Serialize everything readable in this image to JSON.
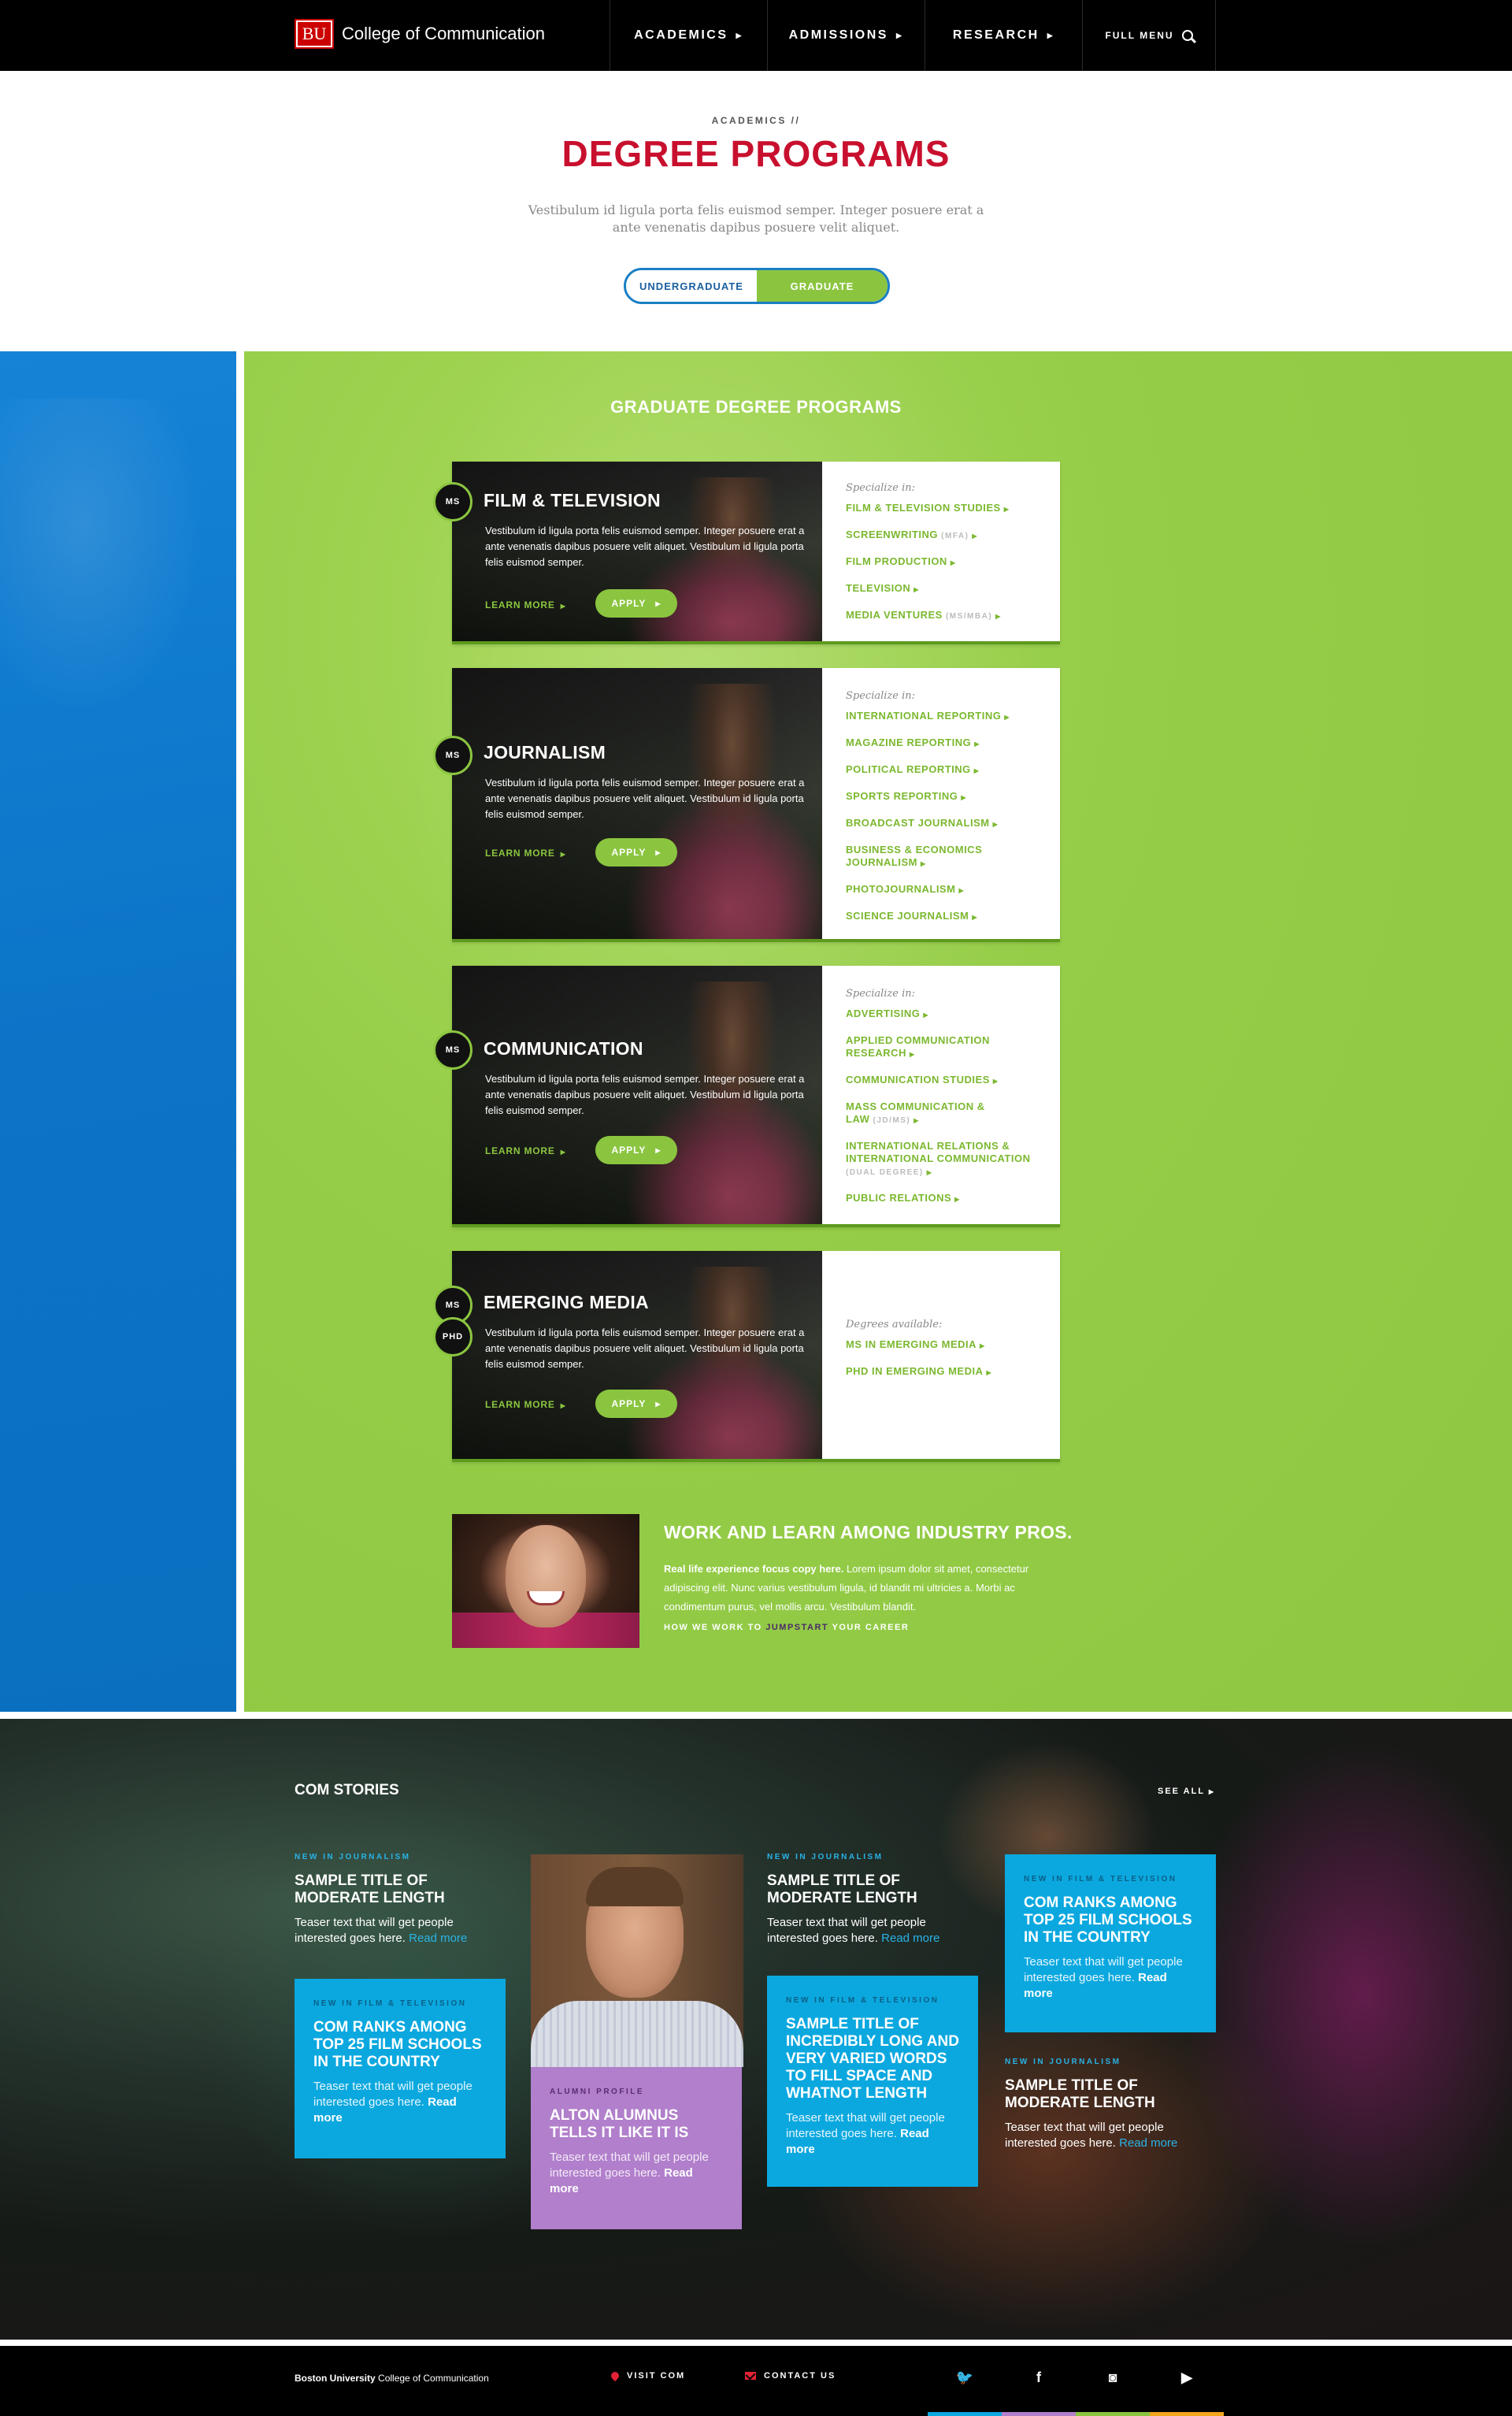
{
  "header": {
    "logo_text": "BU",
    "site_name": "College of Communication",
    "nav": [
      {
        "label": "ACADEMICS"
      },
      {
        "label": "ADMISSIONS"
      },
      {
        "label": "RESEARCH"
      },
      {
        "label": "FULL MENU"
      }
    ]
  },
  "intro": {
    "breadcrumb": "ACADEMICS //",
    "title": "DEGREE PROGRAMS",
    "text": "Vestibulum id ligula porta felis euismod semper. Integer posuere erat a ante venenatis dapibus posuere velit aliquet.",
    "toggle": {
      "undergraduate": "UNDERGRADUATE",
      "graduate": "GRADUATE"
    }
  },
  "programs": {
    "section_title": "GRADUATE DEGREE PROGRAMS",
    "cards": [
      {
        "badges": [
          "MS"
        ],
        "name": "FILM & TELEVISION",
        "desc": "Vestibulum id ligula porta felis euismod semper.  Integer posuere erat a ante venenatis dapibus posuere velit aliquet. Vestibulum id ligula porta felis euismod semper.",
        "learn_more": "LEARN MORE",
        "apply": "APPLY",
        "list_label": "Specialize in:",
        "items": [
          {
            "label": "FILM & TELEVISION STUDIES",
            "sub": ""
          },
          {
            "label": "SCREENWRITING",
            "sub": "(MFA)"
          },
          {
            "label": "FILM PRODUCTION",
            "sub": ""
          },
          {
            "label": "TELEVISION",
            "sub": ""
          },
          {
            "label": "MEDIA VENTURES",
            "sub": "(MS/MBA)"
          }
        ]
      },
      {
        "badges": [
          "MS"
        ],
        "name": "JOURNALISM",
        "desc": "Vestibulum id ligula porta felis euismod semper.  Integer posuere erat a ante venenatis dapibus posuere velit aliquet. Vestibulum id ligula porta felis euismod semper.",
        "learn_more": "LEARN MORE",
        "apply": "APPLY",
        "list_label": "Specialize in:",
        "items": [
          {
            "label": "INTERNATIONAL REPORTING",
            "sub": ""
          },
          {
            "label": "MAGAZINE REPORTING",
            "sub": ""
          },
          {
            "label": "POLITICAL REPORTING",
            "sub": ""
          },
          {
            "label": "SPORTS REPORTING",
            "sub": ""
          },
          {
            "label": "BROADCAST JOURNALISM",
            "sub": ""
          },
          {
            "label": "BUSINESS & ECONOMICS JOURNALISM",
            "sub": ""
          },
          {
            "label": "PHOTOJOURNALISM",
            "sub": ""
          },
          {
            "label": "SCIENCE JOURNALISM",
            "sub": ""
          }
        ]
      },
      {
        "badges": [
          "MS"
        ],
        "name": "COMMUNICATION",
        "desc": "Vestibulum id ligula porta felis euismod semper.  Integer posuere erat a ante venenatis dapibus posuere velit aliquet. Vestibulum id ligula porta felis euismod semper.",
        "learn_more": "LEARN MORE",
        "apply": "APPLY",
        "list_label": "Specialize in:",
        "items": [
          {
            "label": "ADVERTISING",
            "sub": ""
          },
          {
            "label": "APPLIED COMMUNICATION RESEARCH",
            "sub": ""
          },
          {
            "label": "COMMUNICATION STUDIES",
            "sub": ""
          },
          {
            "label": "MASS COMMUNICATION & LAW",
            "sub": "(JD/MS)"
          },
          {
            "label": "INTERNATIONAL RELATIONS & INTERNATIONAL COMMUNICATION",
            "sub": "(DUAL DEGREE)"
          },
          {
            "label": "PUBLIC RELATIONS",
            "sub": ""
          }
        ]
      },
      {
        "badges": [
          "MS",
          "PHD"
        ],
        "name": "EMERGING MEDIA",
        "desc": "Vestibulum id ligula porta felis euismod semper.  Integer posuere erat a ante venenatis dapibus posuere velit aliquet. Vestibulum id ligula porta felis euismod semper.",
        "learn_more": "LEARN MORE",
        "apply": "APPLY",
        "list_label": "Degrees available:",
        "items": [
          {
            "label": "MS IN EMERGING MEDIA",
            "sub": ""
          },
          {
            "label": "PHD IN EMERGING MEDIA",
            "sub": ""
          }
        ]
      }
    ],
    "promo": {
      "title": "WORK AND LEARN AMONG INDUSTRY PROS.",
      "lead": "Real life experience focus copy here.",
      "body": " Lorem ipsum dolor sit amet, consectetur adipiscing elit. Nunc varius vestibulum ligula, id blandit mi ultricies a. Morbi ac condimentum purus, vel mollis arcu. Vestibulum blandit.",
      "link_pre": "HOW WE WORK TO ",
      "link_hl": "JUMPSTART",
      "link_post": " YOUR CAREER"
    }
  },
  "stories": {
    "title": "COM STORIES",
    "see_all": "SEE ALL",
    "items": [
      {
        "category": "NEW IN JOURNALISM",
        "title": "SAMPLE TITLE OF MODERATE LENGTH",
        "teaser": "Teaser text that will get people interested goes here.",
        "read_more": "Read more"
      },
      {
        "category": "NEW IN FILM & TELEVISION",
        "title": "COM RANKS AMONG TOP 25 FILM SCHOOLS IN THE COUNTRY",
        "teaser": "Teaser text that will get people interested goes here.",
        "read_more": "Read more"
      },
      {
        "category": "ALUMNI PROFILE",
        "title": "ALTON ALUMNUS TELLS IT LIKE IT IS",
        "teaser": "Teaser text that will get people interested goes here.",
        "read_more": "Read more"
      },
      {
        "category": "NEW IN JOURNALISM",
        "title": "SAMPLE TITLE OF MODERATE LENGTH",
        "teaser": "Teaser text that will get people interested goes here.",
        "read_more": "Read more"
      },
      {
        "category": "NEW IN FILM & TELEVISION",
        "title": "SAMPLE TITLE OF INCREDIBLY LONG AND VERY VARIED WORDS TO FILL SPACE AND WHATNOT LENGTH",
        "teaser": "Teaser text that will get people interested goes here.",
        "read_more": "Read more"
      },
      {
        "category": "NEW IN FILM & TELEVISION",
        "title": "COM RANKS AMONG TOP 25 FILM SCHOOLS IN THE COUNTRY",
        "teaser": "Teaser text that will get people interested goes here.",
        "read_more": "Read more"
      },
      {
        "category": "NEW IN JOURNALISM",
        "title": "SAMPLE TITLE OF MODERATE LENGTH",
        "teaser": "Teaser text that will get people interested goes here.",
        "read_more": "Read more"
      }
    ]
  },
  "footer": {
    "brand_bold": "Boston University",
    "brand_rest": " College of Communication",
    "visit": "VISIT COM",
    "contact": "CONTACT US",
    "social": [
      {
        "icon": "twitter-icon",
        "glyph": "🐦",
        "color": "#0ba8df"
      },
      {
        "icon": "facebook-icon",
        "glyph": "f",
        "color": "#b17fcb"
      },
      {
        "icon": "instagram-icon",
        "glyph": "◙",
        "color": "#8bc540"
      },
      {
        "icon": "youtube-icon",
        "glyph": "▶",
        "color": "#f2a51c"
      }
    ]
  },
  "colors": {
    "accent_red": "#c8102e",
    "green": "#8bc540",
    "blue": "#0b74c7",
    "story_blue": "#0ba8df",
    "story_purple": "#b17fcb"
  }
}
